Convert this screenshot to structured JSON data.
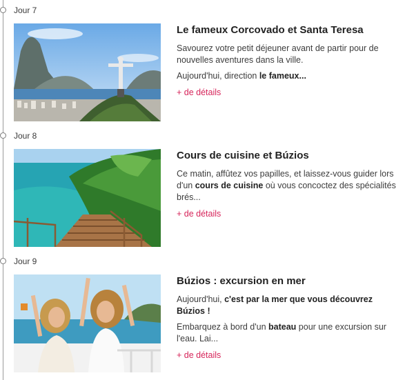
{
  "days": [
    {
      "label": "Jour 7",
      "title": "Le fameux Corcovado et Santa Teresa",
      "paragraphs": [
        {
          "text": "Savourez votre petit déjeuner avant de partir pour de nouvelles aventures dans la ville."
        },
        {
          "prefix": "Aujourd'hui, direction ",
          "bold": "le fameux...",
          "suffix": ""
        }
      ],
      "details": "+ de détails",
      "image": "corcovado-rio-photo"
    },
    {
      "label": "Jour 8",
      "title": "Cours de cuisine et Búzios",
      "paragraphs": [
        {
          "prefix": "Ce matin, affûtez vos papilles, et laissez-vous guider lors d'un ",
          "bold": "cours de cuisine",
          "suffix": " où vous concoctez des spécialités brés..."
        }
      ],
      "details": "+ de détails",
      "image": "coastal-stairs-photo"
    },
    {
      "label": "Jour 9",
      "title": "Búzios : excursion en mer",
      "paragraphs": [
        {
          "prefix": "Aujourd'hui, ",
          "bold": "c'est par la mer que vous découvrez Búzios !",
          "suffix": ""
        },
        {
          "prefix": "Embarquez à bord d'un ",
          "bold": "bateau",
          "suffix": " pour une excursion sur l'eau. Lai..."
        }
      ],
      "details": "+ de détails",
      "image": "boat-friends-photo"
    }
  ],
  "colors": {
    "accent": "#d6245a",
    "timeline": "#9a9a9a"
  }
}
